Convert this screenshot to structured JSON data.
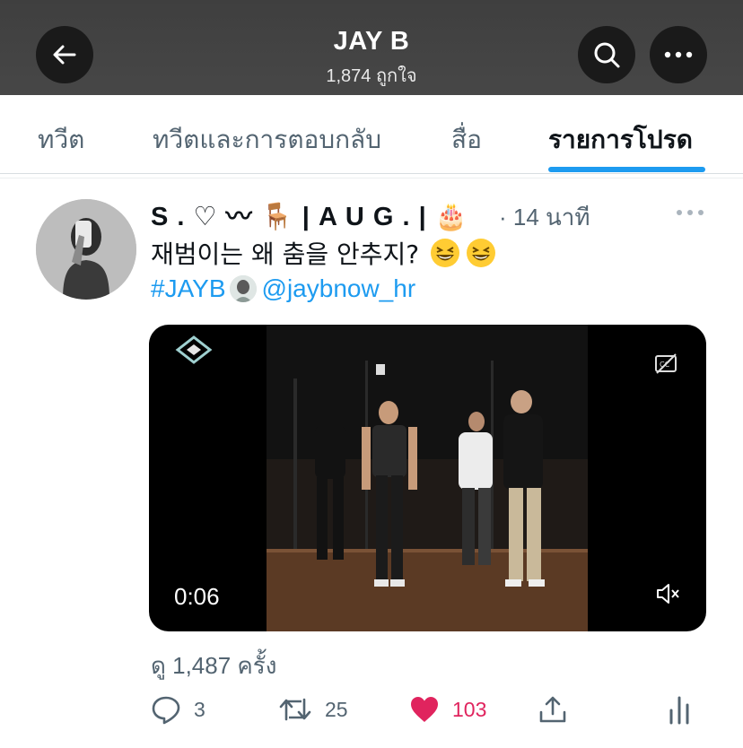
{
  "header": {
    "title": "JAY B",
    "subtitle": "1,874 ถูกใจ"
  },
  "tabs": [
    {
      "label": "ทวีต",
      "active": false
    },
    {
      "label": "ทวีตและการตอบกลับ",
      "active": false
    },
    {
      "label": "สื่อ",
      "active": false
    },
    {
      "label": "รายการโปรด",
      "active": true
    }
  ],
  "tweet": {
    "display_name": "S . ♡ 〰 🪑 | A U G . | 🎂",
    "time": "· 14 นาที",
    "text": "재범이는 왜 춤을 안추지?",
    "hashtag": "#JAYB",
    "mention": "@jaybnow_hr",
    "video_time": "0:06",
    "views": "ดู 1,487 ครั้ง",
    "replies": "3",
    "retweets": "25",
    "likes": "103"
  },
  "colors": {
    "accent": "#1d9bf0",
    "like": "#e0245e",
    "header_bg": "#444444"
  },
  "icons": [
    "back-arrow-icon",
    "search-icon",
    "more-dots-icon",
    "reply-icon",
    "retweet-icon",
    "heart-icon",
    "share-icon",
    "analytics-icon",
    "captions-icon",
    "mute-icon"
  ]
}
